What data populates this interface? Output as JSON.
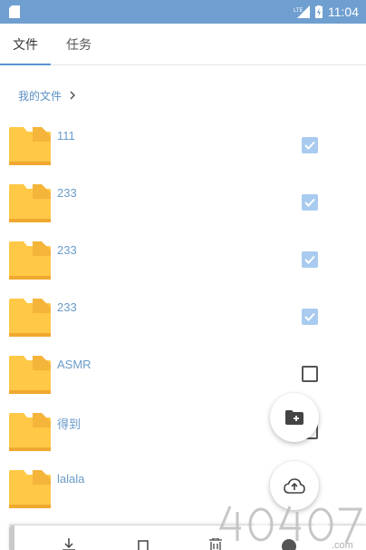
{
  "status_bar": {
    "time": "11:04",
    "network": "LTE"
  },
  "tabs": [
    {
      "label": "文件",
      "active": true
    },
    {
      "label": "任务",
      "active": false
    }
  ],
  "breadcrumb": {
    "label": "我的文件"
  },
  "files": [
    {
      "name": "111",
      "checked": true
    },
    {
      "name": "233",
      "checked": true
    },
    {
      "name": "233",
      "checked": true
    },
    {
      "name": "233",
      "checked": true
    },
    {
      "name": "ASMR",
      "checked": false
    },
    {
      "name": "得到",
      "checked": false
    },
    {
      "name": "lalala",
      "checked": false
    }
  ],
  "colors": {
    "status_bar": "#6f9fd0",
    "accent": "#5a93cf",
    "folder": "#ffc846",
    "folder_dark": "#f5b43a",
    "checkbox_checked": "#a9cbef",
    "file_name": "#6a9bc9"
  },
  "icons": {
    "fab_new_folder": "new-folder-icon",
    "fab_upload": "cloud-upload-icon"
  },
  "watermark": {
    "text": "4O4O7",
    "suffix": ".com"
  }
}
